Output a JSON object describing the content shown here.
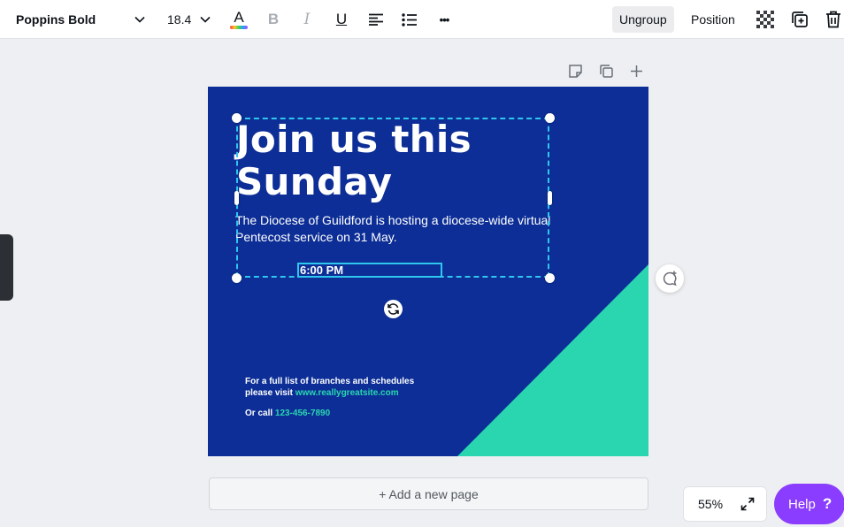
{
  "toolbar": {
    "font_name": "Poppins Bold",
    "font_size": "18.4",
    "text_color_letter": "A",
    "bold_letter": "B",
    "italic_letter": "I",
    "underline_letter": "U",
    "more_glyph": "•••",
    "ungroup_label": "Ungroup",
    "position_label": "Position"
  },
  "design": {
    "title": "Join us this Sunday",
    "subtitle": "The Diocese of Guildford is hosting a diocese-wide virtual Pentecost service on 31 May.",
    "time": "6:00 PM",
    "info_line1": "For a full list of branches and schedules",
    "info_line2_prefix": "please visit ",
    "website": "www.reallygreatsite.com",
    "call_prefix": "Or call ",
    "phone": "123-456-7890"
  },
  "add_page_label": "+ Add a new page",
  "zoom": "55%",
  "help_label": "Help",
  "help_icon": "?",
  "colors": {
    "design_background": "#0c2e96",
    "accent_teal": "#2ad6b0",
    "selection": "#2ec7ee",
    "help_purple": "#8b3dff"
  }
}
